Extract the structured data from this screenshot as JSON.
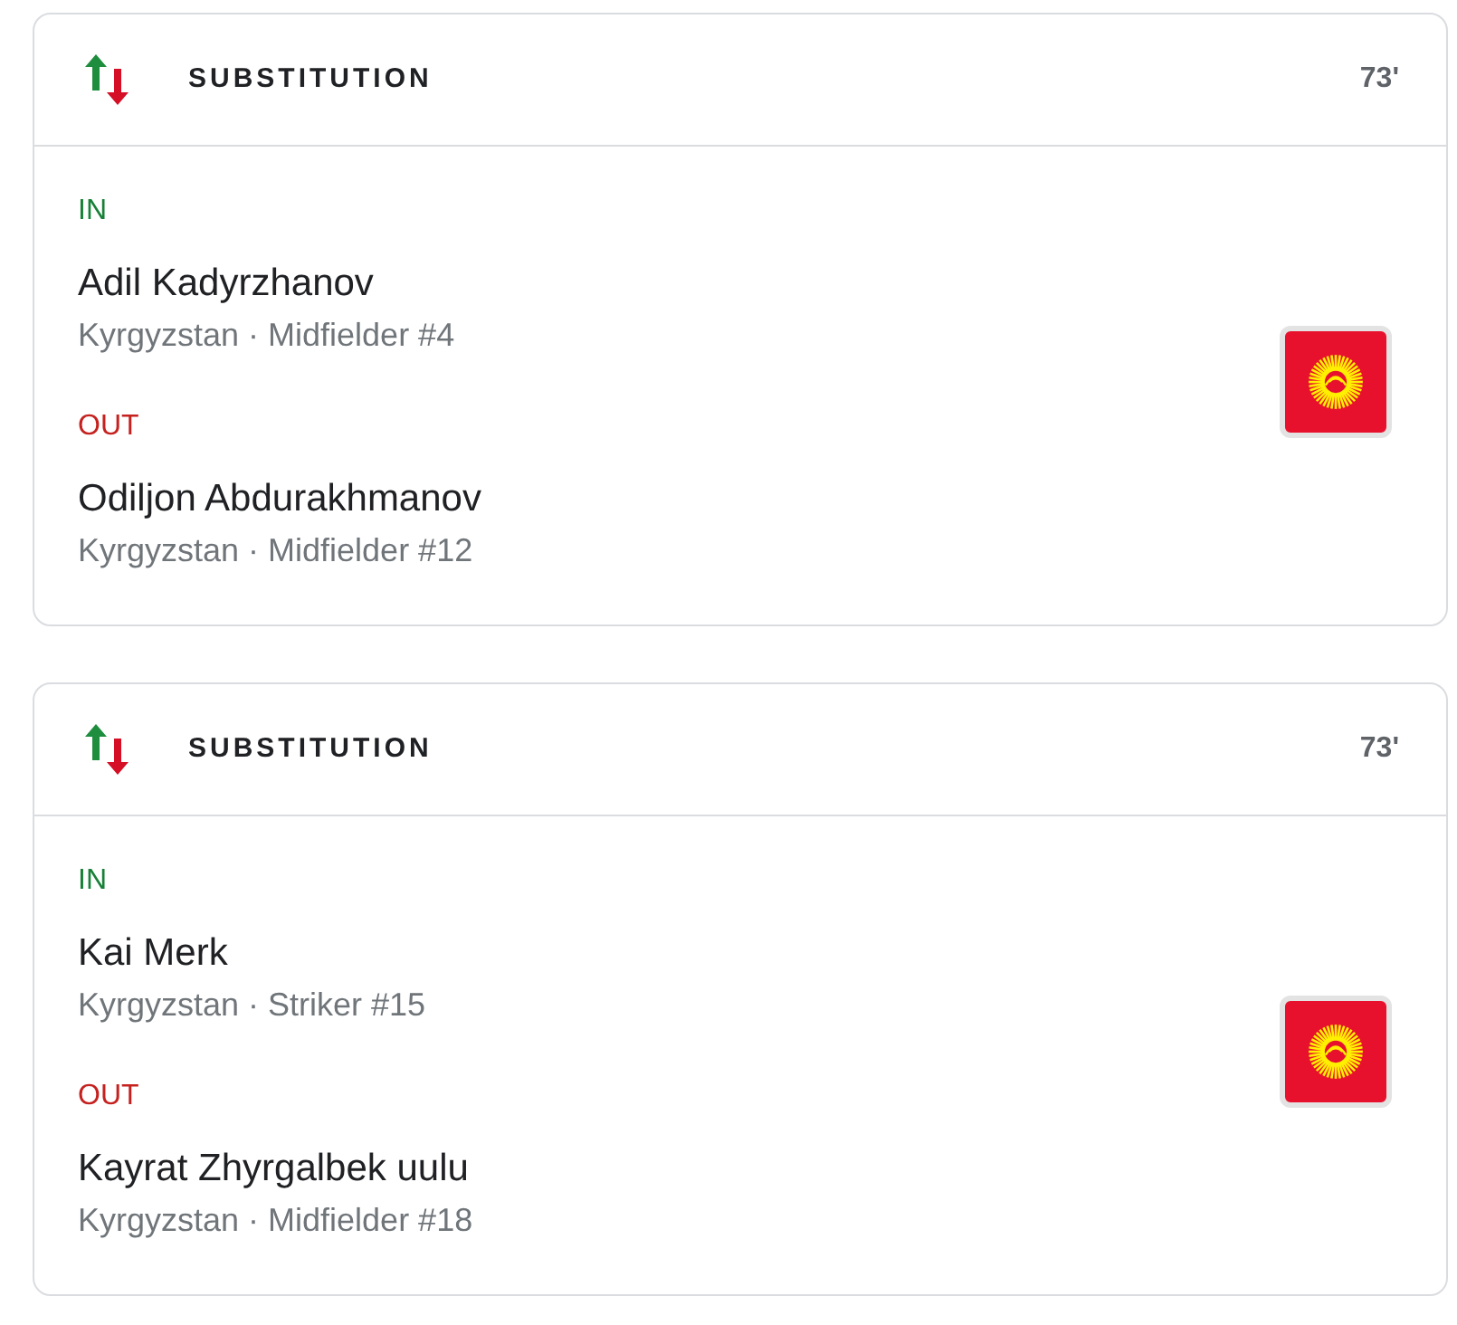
{
  "events": [
    {
      "title": "SUBSTITUTION",
      "minute": "73'",
      "players": [
        {
          "kind": "in",
          "label": "IN",
          "name": "Adil Kadyrzhanov",
          "detail": "Kyrgyzstan · Midfielder #4"
        },
        {
          "kind": "out",
          "label": "OUT",
          "name": "Odiljon Abdurakhmanov",
          "detail": "Kyrgyzstan · Midfielder #12"
        }
      ]
    },
    {
      "title": "SUBSTITUTION",
      "minute": "73'",
      "players": [
        {
          "kind": "in",
          "label": "IN",
          "name": "Kai Merk",
          "detail": "Kyrgyzstan · Striker #15"
        },
        {
          "kind": "out",
          "label": "OUT",
          "name": "Kayrat Zhyrgalbek uulu",
          "detail": "Kyrgyzstan · Midfielder #18"
        }
      ]
    }
  ]
}
